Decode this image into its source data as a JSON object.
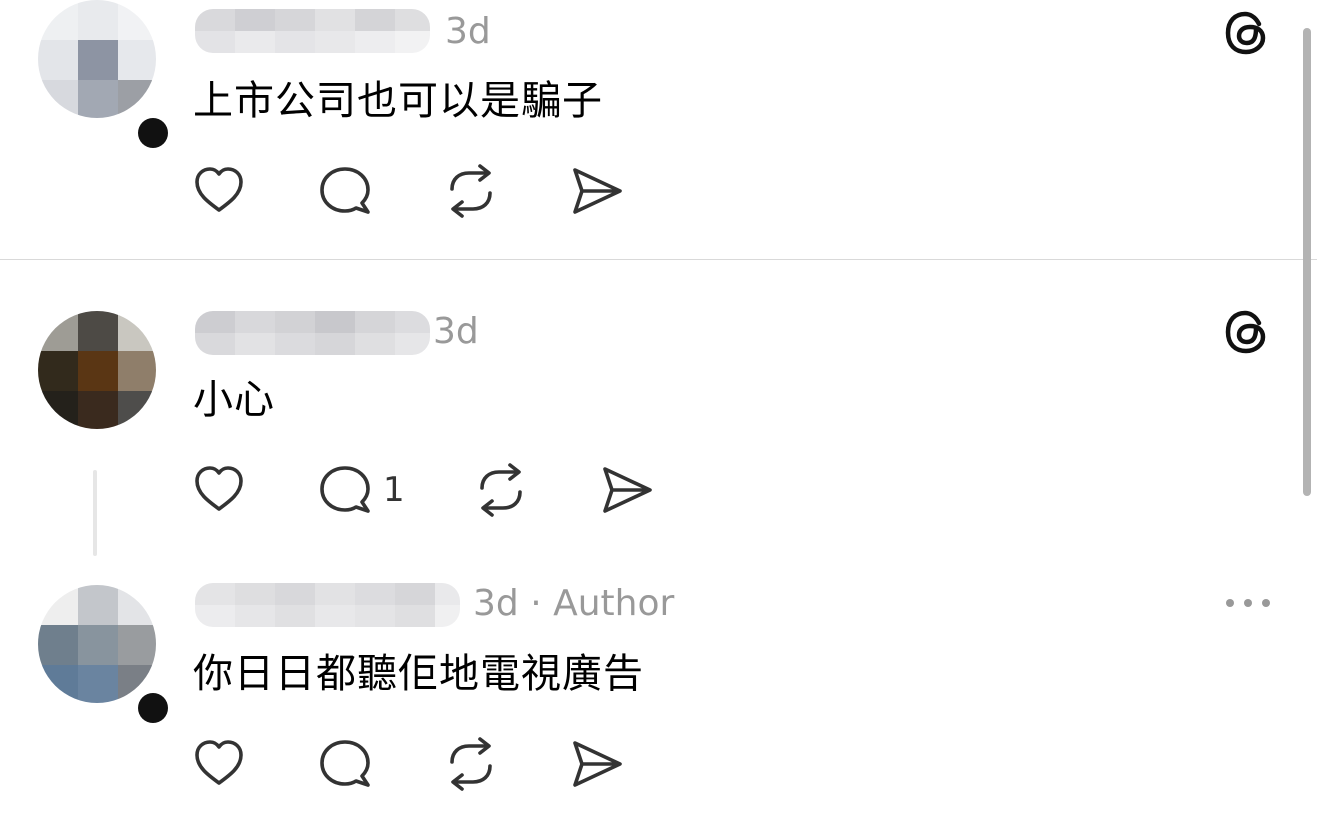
{
  "posts": [
    {
      "time": "3d",
      "author_tag": "",
      "text": "上市公司也可以是騙子",
      "reply_count": "",
      "corner_icon": "threads-logo-icon"
    },
    {
      "time": "3d",
      "author_tag": "",
      "text": "小心",
      "reply_count": "1",
      "corner_icon": "threads-logo-icon"
    },
    {
      "time": "3d",
      "author_tag": " · Author",
      "text": "你日日都聽佢地電視廣告",
      "reply_count": "",
      "corner_icon": "more-options-icon"
    }
  ],
  "icons": {
    "like": "heart-icon",
    "reply": "speech-bubble-icon",
    "repost": "repost-icon",
    "share": "send-icon"
  },
  "colors": {
    "text": "#000000",
    "meta": "#999999",
    "icon": "#333333",
    "divider": "#d9d9d9"
  }
}
